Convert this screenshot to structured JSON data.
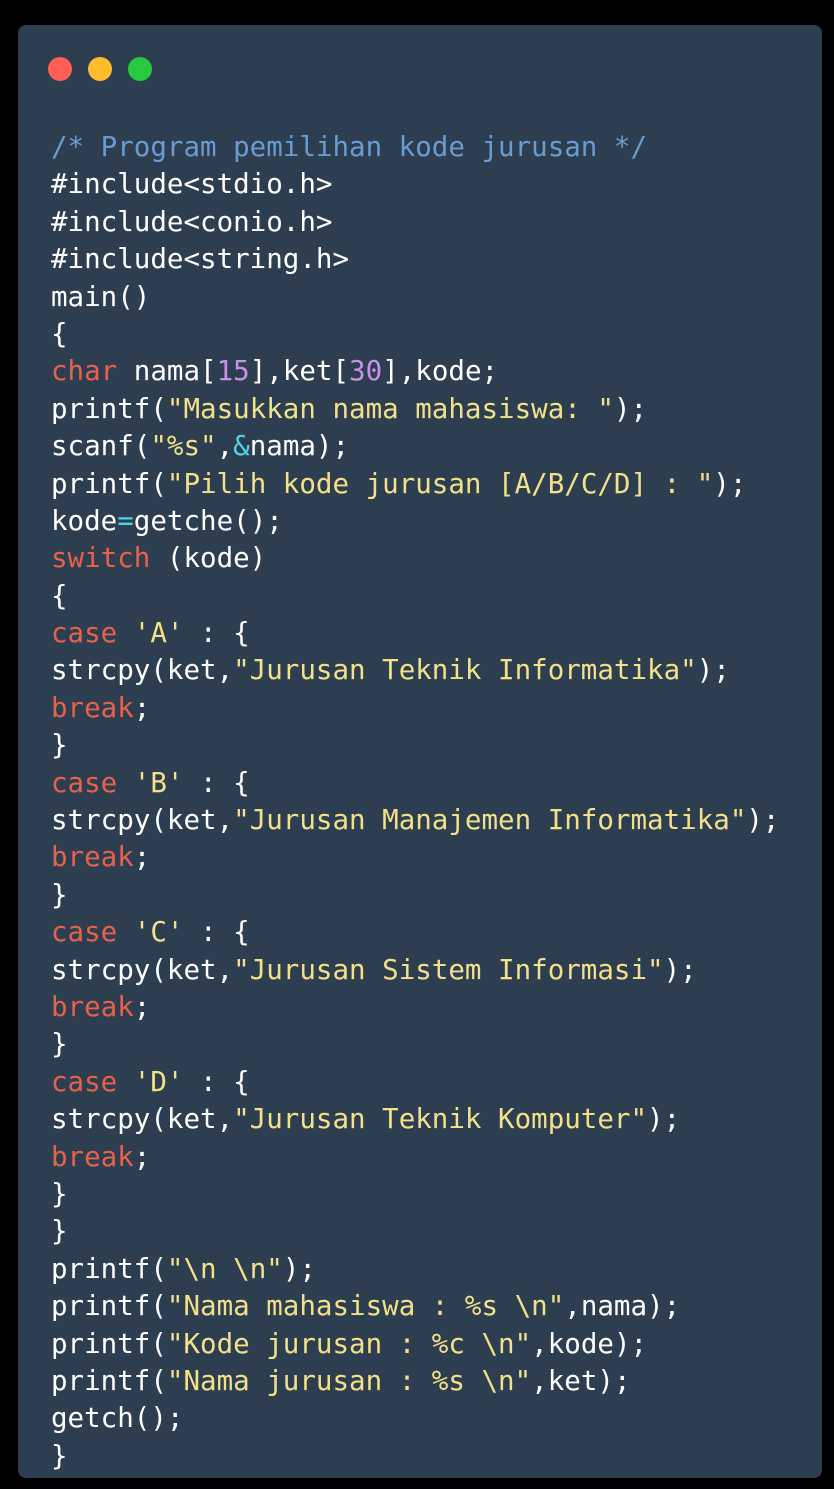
{
  "window": {
    "controls": [
      {
        "name": "close-window-button",
        "color": "#ff5f56"
      },
      {
        "name": "minimize-window-button",
        "color": "#ffbd2e"
      },
      {
        "name": "maximize-window-button",
        "color": "#27c93f"
      }
    ]
  },
  "colors": {
    "background": "#2c3e50",
    "plain": "#ffffff",
    "comment": "#6b9bd1",
    "keyword": "#e8614c",
    "number": "#c792ea",
    "string": "#f2e08a",
    "operator": "#4fd3e6"
  },
  "code": {
    "lines": [
      [
        [
          "comment",
          "/* Program pemilihan kode jurusan */"
        ]
      ],
      [
        [
          "plain",
          "#include<stdio.h>"
        ]
      ],
      [
        [
          "plain",
          "#include<conio.h>"
        ]
      ],
      [
        [
          "plain",
          "#include<string.h>"
        ]
      ],
      [
        [
          "plain",
          "main()"
        ]
      ],
      [
        [
          "plain",
          "{"
        ]
      ],
      [
        [
          "keyword",
          "char"
        ],
        [
          "plain",
          " nama["
        ],
        [
          "number",
          "15"
        ],
        [
          "plain",
          "],ket["
        ],
        [
          "number",
          "30"
        ],
        [
          "plain",
          "],kode;"
        ]
      ],
      [
        [
          "plain",
          "printf("
        ],
        [
          "string",
          "\"Masukkan nama mahasiswa: \""
        ],
        [
          "plain",
          ");"
        ]
      ],
      [
        [
          "plain",
          "scanf("
        ],
        [
          "string",
          "\"%s\""
        ],
        [
          "plain",
          ","
        ],
        [
          "operator",
          "&"
        ],
        [
          "plain",
          "nama);"
        ]
      ],
      [
        [
          "plain",
          "printf("
        ],
        [
          "string",
          "\"Pilih kode jurusan [A/B/C/D] : \""
        ],
        [
          "plain",
          ");"
        ]
      ],
      [
        [
          "plain",
          "kode"
        ],
        [
          "operator",
          "="
        ],
        [
          "plain",
          "getche();"
        ]
      ],
      [
        [
          "keyword",
          "switch"
        ],
        [
          "plain",
          " (kode)"
        ]
      ],
      [
        [
          "plain",
          "{"
        ]
      ],
      [
        [
          "keyword",
          "case"
        ],
        [
          "plain",
          " "
        ],
        [
          "string",
          "'A'"
        ],
        [
          "plain",
          " : {"
        ]
      ],
      [
        [
          "plain",
          "strcpy(ket,"
        ],
        [
          "string",
          "\"Jurusan Teknik Informatika\""
        ],
        [
          "plain",
          ");"
        ]
      ],
      [
        [
          "keyword",
          "break"
        ],
        [
          "plain",
          ";"
        ]
      ],
      [
        [
          "plain",
          "}"
        ]
      ],
      [
        [
          "keyword",
          "case"
        ],
        [
          "plain",
          " "
        ],
        [
          "string",
          "'B'"
        ],
        [
          "plain",
          " : {"
        ]
      ],
      [
        [
          "plain",
          "strcpy(ket,"
        ],
        [
          "string",
          "\"Jurusan Manajemen Informatika\""
        ],
        [
          "plain",
          ");"
        ]
      ],
      [
        [
          "keyword",
          "break"
        ],
        [
          "plain",
          ";"
        ]
      ],
      [
        [
          "plain",
          "}"
        ]
      ],
      [
        [
          "keyword",
          "case"
        ],
        [
          "plain",
          " "
        ],
        [
          "string",
          "'C'"
        ],
        [
          "plain",
          " : {"
        ]
      ],
      [
        [
          "plain",
          "strcpy(ket,"
        ],
        [
          "string",
          "\"Jurusan Sistem Informasi\""
        ],
        [
          "plain",
          ");"
        ]
      ],
      [
        [
          "keyword",
          "break"
        ],
        [
          "plain",
          ";"
        ]
      ],
      [
        [
          "plain",
          "}"
        ]
      ],
      [
        [
          "keyword",
          "case"
        ],
        [
          "plain",
          " "
        ],
        [
          "string",
          "'D'"
        ],
        [
          "plain",
          " : {"
        ]
      ],
      [
        [
          "plain",
          "strcpy(ket,"
        ],
        [
          "string",
          "\"Jurusan Teknik Komputer\""
        ],
        [
          "plain",
          ");"
        ]
      ],
      [
        [
          "keyword",
          "break"
        ],
        [
          "plain",
          ";"
        ]
      ],
      [
        [
          "plain",
          "}"
        ]
      ],
      [
        [
          "plain",
          "}"
        ]
      ],
      [
        [
          "plain",
          "printf("
        ],
        [
          "string",
          "\"\\n \\n\""
        ],
        [
          "plain",
          ");"
        ]
      ],
      [
        [
          "plain",
          "printf("
        ],
        [
          "string",
          "\"Nama mahasiswa : %s \\n\""
        ],
        [
          "plain",
          ",nama);"
        ]
      ],
      [
        [
          "plain",
          "printf("
        ],
        [
          "string",
          "\"Kode jurusan : %c \\n\""
        ],
        [
          "plain",
          ",kode);"
        ]
      ],
      [
        [
          "plain",
          "printf("
        ],
        [
          "string",
          "\"Nama jurusan : %s \\n\""
        ],
        [
          "plain",
          ",ket);"
        ]
      ],
      [
        [
          "plain",
          "getch();"
        ]
      ],
      [
        [
          "plain",
          "}"
        ]
      ]
    ]
  }
}
